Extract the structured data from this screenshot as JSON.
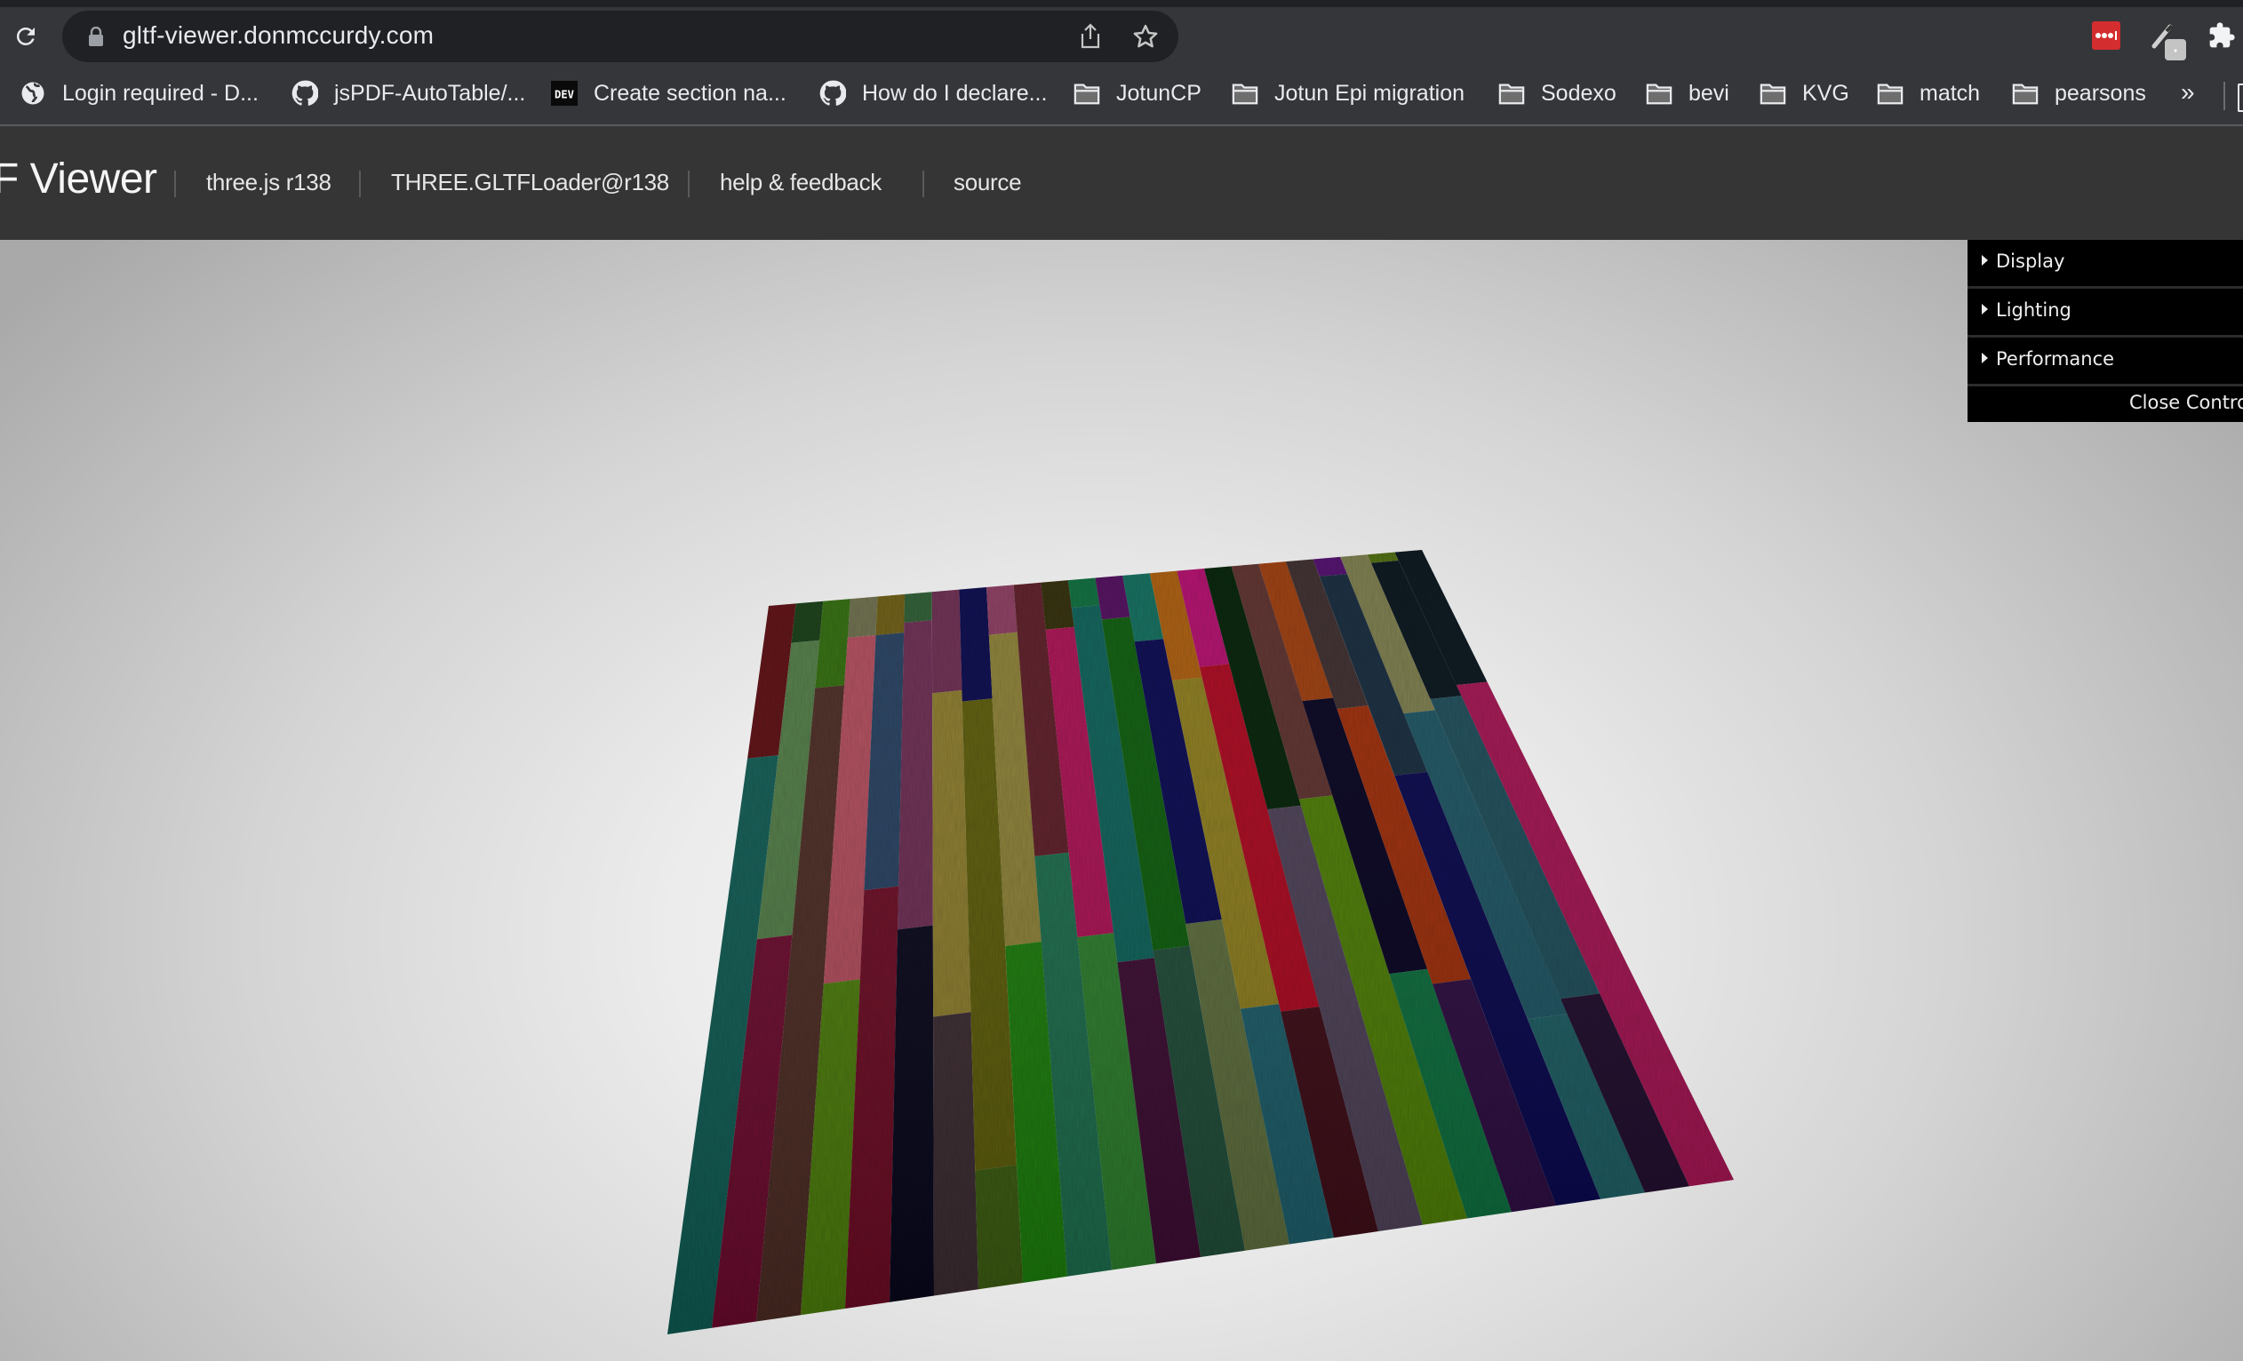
{
  "browser": {
    "url": "gltf-viewer.donmccurdy.com",
    "icons": {
      "reload": "reload-icon",
      "lock": "lock-icon",
      "share": "share-icon",
      "bookmark_star": "star-icon",
      "lastpass": "lastpass-extension-icon",
      "eyedropper": "eyedropper-extension-icon",
      "extensions": "puzzle-icon"
    },
    "bookmarks": [
      {
        "label": "Login required - D...",
        "icon": "globe-icon"
      },
      {
        "label": "jsPDF-AutoTable/...",
        "icon": "github-icon"
      },
      {
        "label": "Create section na...",
        "icon": "dev-icon"
      },
      {
        "label": "How do I declare...",
        "icon": "github-icon"
      },
      {
        "label": "JotunCP",
        "icon": "folder-icon"
      },
      {
        "label": "Jotun Epi migration",
        "icon": "folder-icon"
      },
      {
        "label": "Sodexo",
        "icon": "folder-icon"
      },
      {
        "label": "bevi",
        "icon": "folder-icon"
      },
      {
        "label": "KVG",
        "icon": "folder-icon"
      },
      {
        "label": "match",
        "icon": "folder-icon"
      },
      {
        "label": "pearsons",
        "icon": "folder-icon"
      }
    ],
    "bookmarks_overflow": "»",
    "dev_badge": "DEV"
  },
  "app": {
    "title": "F Viewer",
    "nav": [
      "three.js r138",
      "THREE.GLTFLoader@r138",
      "help & feedback",
      "source"
    ]
  },
  "gui": {
    "folders": [
      "Display",
      "Lighting",
      "Performance"
    ],
    "close_label": "Close Controls"
  },
  "scene": {
    "model": "striped wooden rug",
    "columns": [
      [
        [
          "#5a0a0e",
          0.28
        ],
        [
          "#0e5a52",
          1
        ]
      ],
      [
        [
          "#143a12",
          0.08
        ],
        [
          "#4f7a44",
          0.55
        ],
        [
          "#6a0a2c",
          1
        ]
      ],
      [
        [
          "#2f6a0a",
          0.17
        ],
        [
          "#4a2a22",
          1
        ]
      ],
      [
        [
          "#6b6b4a",
          0.08
        ],
        [
          "#b04a5a",
          0.62
        ],
        [
          "#4a7a0a",
          1
        ]
      ],
      [
        [
          "#6a5a10",
          0.08
        ],
        [
          "#243e5e",
          0.5
        ],
        [
          "#6a0a22",
          1
        ]
      ],
      [
        [
          "#2a5a30",
          0.06
        ],
        [
          "#6a2a50",
          0.56
        ],
        [
          "#06061a",
          1
        ]
      ],
      [
        [
          "#6a2a4e",
          0.2
        ],
        [
          "#8a7a2a",
          0.68
        ],
        [
          "#3a2a30",
          1
        ]
      ],
      [
        [
          "#06064a",
          0.22
        ],
        [
          "#5a5a08",
          0.87
        ],
        [
          "#3a5a10",
          1
        ]
      ],
      [
        [
          "#8a3a5e",
          0.1
        ],
        [
          "#8a7e34",
          0.6
        ],
        [
          "#1a7a0a",
          1
        ]
      ],
      [
        [
          "#5a1a24",
          0.48
        ],
        [
          "#1a6a4a",
          1
        ]
      ],
      [
        [
          "#2e2a06",
          0.1
        ],
        [
          "#a80e50",
          0.6
        ],
        [
          "#2a7a2a",
          1
        ]
      ],
      [
        [
          "#0a6a3a",
          0.06
        ],
        [
          "#0a5e56",
          0.64
        ],
        [
          "#3a0a30",
          1
        ]
      ],
      [
        [
          "#4e0a5a",
          0.09
        ],
        [
          "#0a5a0a",
          0.63
        ],
        [
          "#1e4a36",
          1
        ]
      ],
      [
        [
          "#0e6a5a",
          0.14
        ],
        [
          "#06064e",
          0.6
        ],
        [
          "#5a6a3a",
          1
        ]
      ],
      [
        [
          "#a85a0a",
          0.22
        ],
        [
          "#8a7a1a",
          0.72
        ],
        [
          "#1a5a66",
          1
        ]
      ],
      [
        [
          "#b00a6a",
          0.2
        ],
        [
          "#a8041c",
          0.73
        ],
        [
          "#3a0a14",
          1
        ]
      ],
      [
        [
          "#001e04",
          0.45
        ],
        [
          "#4a3e54",
          1
        ]
      ],
      [
        [
          "#5a2e2a",
          0.44
        ],
        [
          "#4a7a02",
          1
        ]
      ],
      [
        [
          "#9a3a0a",
          0.28
        ],
        [
          "#04001e",
          0.7
        ],
        [
          "#0a6a3a",
          1
        ]
      ],
      [
        [
          "#3a2a2a",
          0.3
        ],
        [
          "#9a2a06",
          0.72
        ],
        [
          "#2a0a3e",
          1
        ]
      ],
      [
        [
          "#4e0a6a",
          0.04
        ],
        [
          "#13283a",
          0.42
        ],
        [
          "#06044a",
          1
        ]
      ],
      [
        [
          "#7a7a4a",
          0.32
        ],
        [
          "#1a5260",
          0.78
        ],
        [
          "#1a5a60",
          1
        ]
      ],
      [
        [
          "#4a6a0a",
          0.02
        ],
        [
          "#041018",
          0.3
        ],
        [
          "#1a4a56",
          0.76
        ],
        [
          "#1e0a2a",
          1
        ]
      ],
      [
        [
          "#041018",
          0.28
        ],
        [
          "#a0104e",
          1
        ]
      ]
    ]
  }
}
